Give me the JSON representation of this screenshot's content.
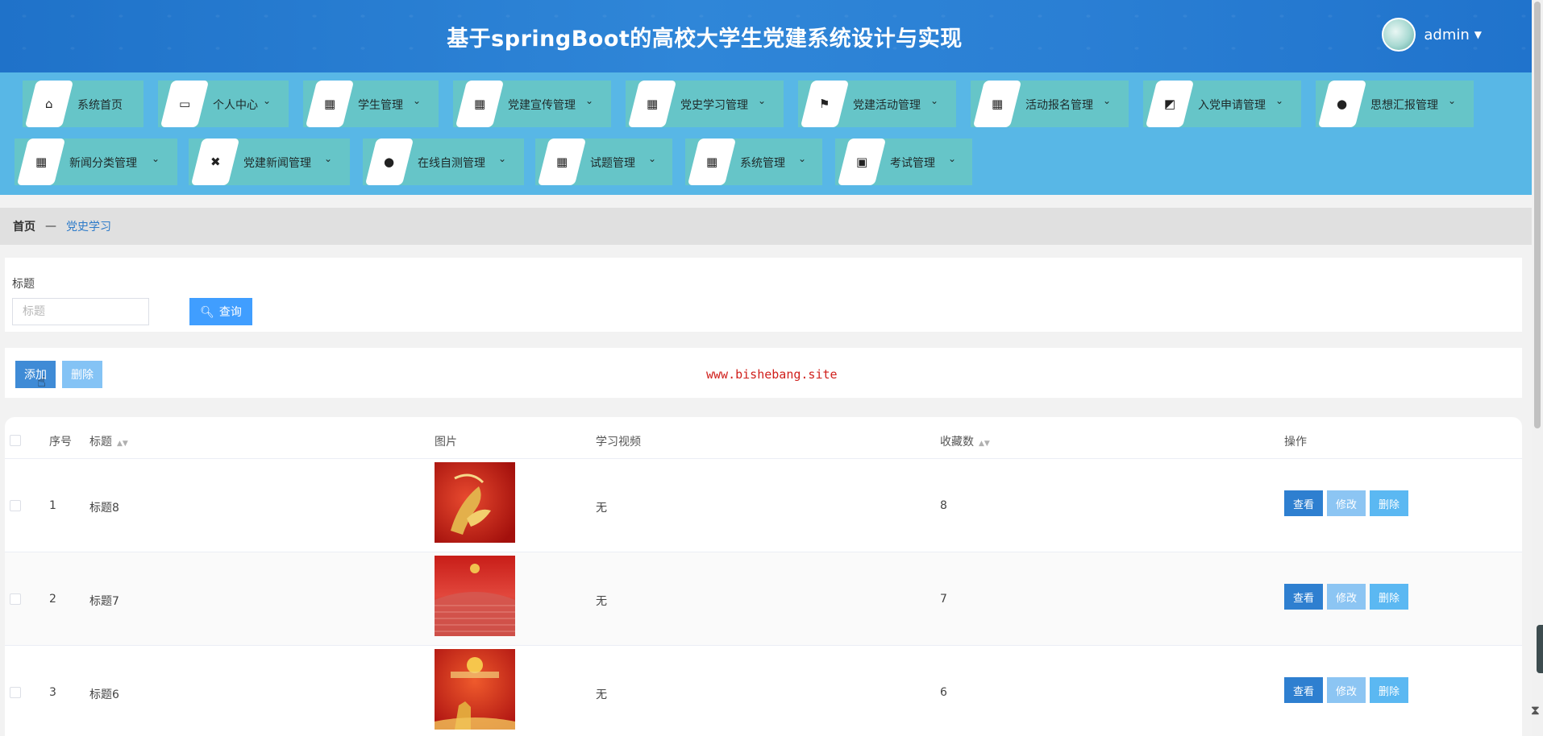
{
  "header": {
    "title": "基于springBoot的高校大学生党建系统设计与实现",
    "username": "admin"
  },
  "nav": {
    "row1": [
      {
        "label": "系统首页",
        "icon": "home-icon",
        "glyph": "⌂",
        "chevron": false
      },
      {
        "label": "个人中心",
        "icon": "wallet-icon",
        "glyph": "▭",
        "chevron": true
      },
      {
        "label": "学生管理",
        "icon": "grid-icon",
        "glyph": "▦",
        "chevron": true
      },
      {
        "label": "党建宣传管理",
        "icon": "grid-icon",
        "glyph": "▦",
        "chevron": true
      },
      {
        "label": "党史学习管理",
        "icon": "grid-icon",
        "glyph": "▦",
        "chevron": true
      },
      {
        "label": "党建活动管理",
        "icon": "flag-icon",
        "glyph": "⚑",
        "chevron": true
      },
      {
        "label": "活动报名管理",
        "icon": "grid-icon",
        "glyph": "▦",
        "chevron": true
      },
      {
        "label": "入党申请管理",
        "icon": "chart-icon",
        "glyph": "◩",
        "chevron": true
      },
      {
        "label": "思想汇报管理",
        "icon": "user-icon",
        "glyph": "●",
        "chevron": true
      }
    ],
    "row2": [
      {
        "label": "新闻分类管理",
        "icon": "grid-icon",
        "glyph": "▦",
        "chevron": true
      },
      {
        "label": "党建新闻管理",
        "icon": "ticket-icon",
        "glyph": "✖",
        "chevron": true
      },
      {
        "label": "在线自测管理",
        "icon": "user-icon",
        "glyph": "●",
        "chevron": true
      },
      {
        "label": "试题管理",
        "icon": "grid-icon",
        "glyph": "▦",
        "chevron": true
      },
      {
        "label": "系统管理",
        "icon": "grid-icon",
        "glyph": "▦",
        "chevron": true
      },
      {
        "label": "考试管理",
        "icon": "clipboard-icon",
        "glyph": "▣",
        "chevron": true
      }
    ]
  },
  "breadcrumb": {
    "home": "首页",
    "sep": "—",
    "current": "党史学习"
  },
  "search": {
    "label": "标题",
    "placeholder": "标题",
    "button": "查询"
  },
  "actions": {
    "add": "添加",
    "delete": "删除",
    "watermark": "www.bishebang.site"
  },
  "table": {
    "headers": {
      "index": "序号",
      "title": "标题",
      "image": "图片",
      "video": "学习视频",
      "favorites": "收藏数",
      "ops": "操作"
    },
    "rows": [
      {
        "index": "1",
        "title": "标题8",
        "video": "无",
        "favorites": "8"
      },
      {
        "index": "2",
        "title": "标题7",
        "video": "无",
        "favorites": "7"
      },
      {
        "index": "3",
        "title": "标题6",
        "video": "无",
        "favorites": "6"
      }
    ],
    "op_labels": {
      "view": "查看",
      "edit": "修改",
      "delete": "删除"
    }
  }
}
